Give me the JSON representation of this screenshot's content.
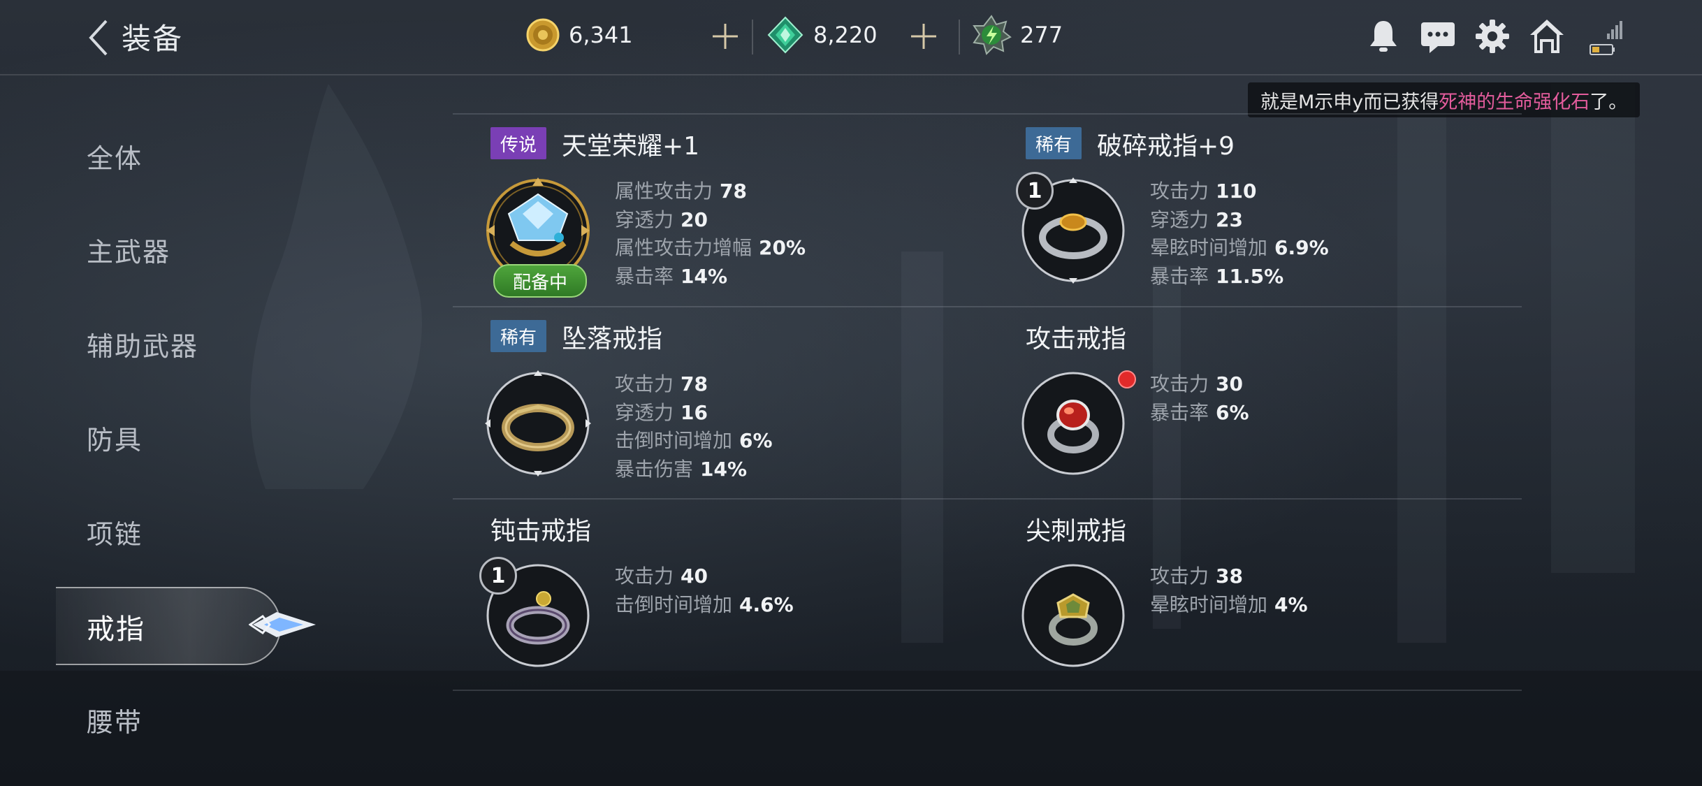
{
  "header": {
    "title": "装备",
    "currencies": [
      {
        "name": "gold",
        "value": "6,341"
      },
      {
        "name": "gem",
        "value": "8,220"
      },
      {
        "name": "energy",
        "value": "277"
      }
    ]
  },
  "notice": {
    "prefix": "就是M示申y而已获得",
    "highlight": "死神的生命强化石",
    "suffix": "了。"
  },
  "sidebar": {
    "items": [
      {
        "label": "全体"
      },
      {
        "label": "主武器"
      },
      {
        "label": "辅助武器"
      },
      {
        "label": "防具"
      },
      {
        "label": "项链"
      },
      {
        "label": "戒指"
      },
      {
        "label": "腰带"
      }
    ],
    "active": "戒指"
  },
  "items": [
    {
      "grade": "传说",
      "name": "天堂荣耀+1",
      "equipped": "配备中",
      "stats": [
        {
          "label": "属性攻击力",
          "value": "78"
        },
        {
          "label": "穿透力",
          "value": "20"
        },
        {
          "label": "属性攻击力增幅",
          "value": "20%"
        },
        {
          "label": "暴击率",
          "value": "14%"
        }
      ]
    },
    {
      "grade": "稀有",
      "name": "破碎戒指+9",
      "count": "1",
      "stats": [
        {
          "label": "攻击力",
          "value": "110"
        },
        {
          "label": "穿透力",
          "value": "23"
        },
        {
          "label": "晕眩时间增加",
          "value": "6.9%"
        },
        {
          "label": "暴击率",
          "value": "11.5%"
        }
      ]
    },
    {
      "grade": "稀有",
      "name": "坠落戒指",
      "stats": [
        {
          "label": "攻击力",
          "value": "78"
        },
        {
          "label": "穿透力",
          "value": "16"
        },
        {
          "label": "击倒时间增加",
          "value": "6%"
        },
        {
          "label": "暴击伤害",
          "value": "14%"
        }
      ]
    },
    {
      "name": "攻击戒指",
      "stats": [
        {
          "label": "攻击力",
          "value": "30"
        },
        {
          "label": "暴击率",
          "value": "6%"
        }
      ]
    },
    {
      "name": "钝击戒指",
      "count": "1",
      "stats": [
        {
          "label": "攻击力",
          "value": "40"
        },
        {
          "label": "击倒时间增加",
          "value": "4.6%"
        }
      ]
    },
    {
      "name": "尖刺戒指",
      "stats": [
        {
          "label": "攻击力",
          "value": "38"
        },
        {
          "label": "晕眩时间增加",
          "value": "4%"
        }
      ]
    }
  ]
}
